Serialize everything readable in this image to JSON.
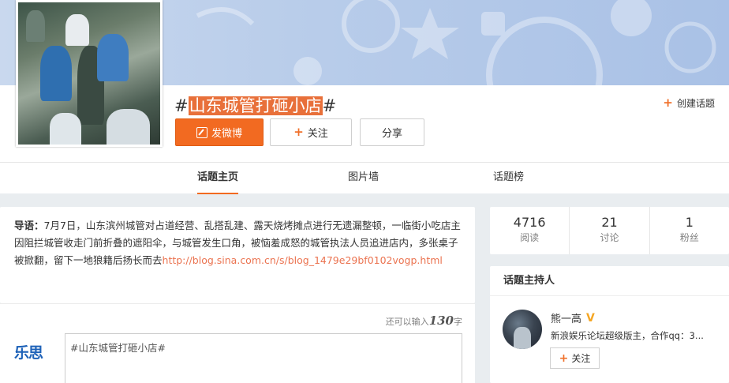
{
  "banner": {},
  "topic": {
    "hash_open": "#",
    "name": "山东城管打砸小店",
    "hash_close": "#"
  },
  "header": {
    "create_topic": "创建话题",
    "post_button": "发微博",
    "follow_button": "关注",
    "share_button": "分享"
  },
  "nav": {
    "tabs": [
      {
        "label": "话题主页",
        "active": true
      },
      {
        "label": "图片墙",
        "active": false
      },
      {
        "label": "话题榜",
        "active": false
      }
    ]
  },
  "intro": {
    "lead_label": "导语：",
    "text": "7月7日，山东滨州城管对占道经营、乱搭乱建、露天烧烤摊点进行无遗漏整顿，一临街小吃店主因阻拦城管收走门前折叠的遮阳伞，与城管发生口角，被恼羞成怒的城管执法人员追进店内，多张桌子被掀翻，留下一地狼籍后扬长而去",
    "link": "http://blog.sina.com.cn/s/blog_1479e29bf0102vogp.html"
  },
  "composer": {
    "counter_prefix": "还可以输入",
    "counter_value": "130",
    "counter_suffix": "字",
    "logo_text": "乐思",
    "input_value": "#山东城管打砸小店#"
  },
  "stats": [
    {
      "value": "4716",
      "label": "阅读"
    },
    {
      "value": "21",
      "label": "讨论"
    },
    {
      "value": "1",
      "label": "粉丝"
    }
  ],
  "host": {
    "section_title": "话题主持人",
    "name": "熊一高",
    "badge": "V",
    "description": "新浪娱乐论坛超级版主，合作qq：3...",
    "follow_button": "关注"
  },
  "colors": {
    "accent": "#f26a21",
    "link": "#eb7350",
    "highlight": "#e8703a"
  }
}
